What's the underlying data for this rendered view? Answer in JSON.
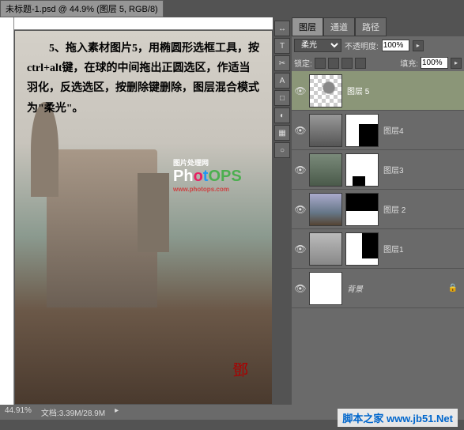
{
  "document": {
    "tab_title": "未标题-1.psd @ 44.9% (图层 5, RGB/8)"
  },
  "instruction": {
    "text": "　　5、拖入素材图片5，用椭圆形选框工具，按ctrl+alt键，在球的中间拖出正圆选区，作适当羽化，反选选区，按删除键删除，图层混合模式为\"柔光\"。"
  },
  "logo": {
    "pre": "图片处理网",
    "main_p": "Ph",
    "main_o": "o",
    "main_t": "t",
    "main_ops": "OPS",
    "url": "www.photops.com"
  },
  "panel": {
    "tabs": [
      "图层",
      "通道",
      "路径"
    ],
    "blend_mode": "柔光",
    "opacity_label": "不透明度:",
    "opacity_value": "100%",
    "lock_label": "锁定:",
    "fill_label": "填充:",
    "fill_value": "100%"
  },
  "layers": [
    {
      "name": "图层 5",
      "selected": true,
      "has_mask": false
    },
    {
      "name": "图层4",
      "selected": false,
      "has_mask": true
    },
    {
      "name": "图层3",
      "selected": false,
      "has_mask": true
    },
    {
      "name": "图层 2",
      "selected": false,
      "has_mask": true
    },
    {
      "name": "图层1",
      "selected": false,
      "has_mask": true
    },
    {
      "name": "背景",
      "selected": false,
      "has_mask": false
    }
  ],
  "status": {
    "zoom": "44.91%",
    "doc_info": "文档:3.39M/28.9M"
  },
  "watermark": "脚本之家 www.jb51.Net",
  "tools": [
    "↔",
    "T",
    "✂",
    "A",
    "□",
    "◐",
    "▦",
    "○"
  ]
}
